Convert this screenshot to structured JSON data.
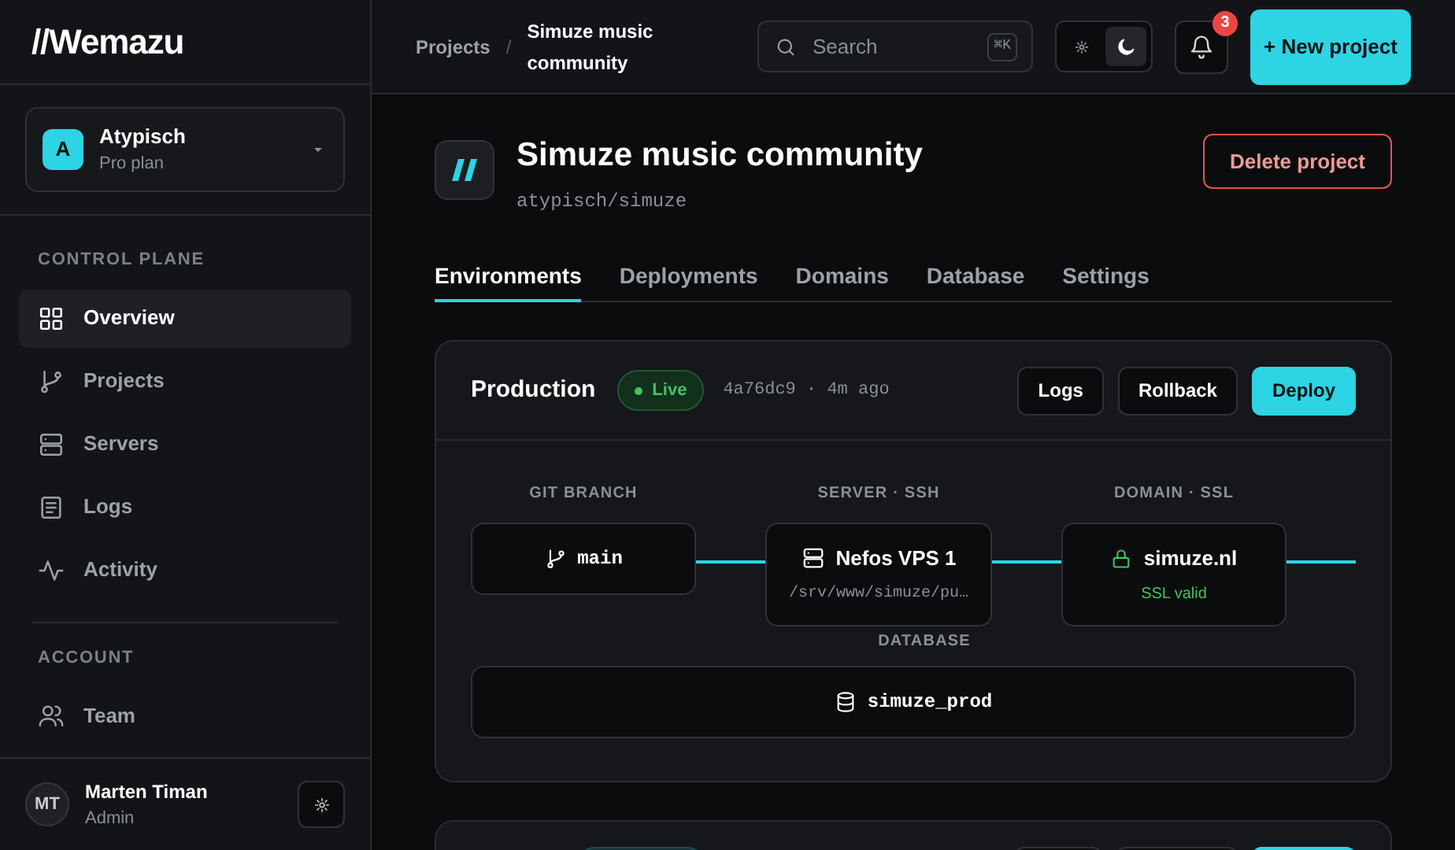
{
  "brand": {
    "logo": "//Wemazu"
  },
  "workspace": {
    "initial": "A",
    "name": "Atypisch",
    "plan": "Pro plan"
  },
  "nav": [
    {
      "heading": "CONTROL PLANE",
      "items": [
        {
          "label": "Overview",
          "selected": true
        },
        {
          "label": "Projects",
          "selected": false
        },
        {
          "label": "Servers",
          "selected": false
        },
        {
          "label": "Logs",
          "selected": false
        },
        {
          "label": "Activity",
          "selected": false
        }
      ]
    },
    {
      "heading": "ACCOUNT",
      "items": [
        {
          "label": "Team",
          "selected": false
        }
      ]
    }
  ],
  "user": {
    "initials": "MT",
    "name": "Marten Timan",
    "role": "Admin"
  },
  "header": {
    "breadcrumb": [
      "Projects",
      "Simuze music community"
    ],
    "separator": "/",
    "search": {
      "placeholder": "Search",
      "shortcut": "⌘K"
    },
    "theme": [
      {
        "kind": "light",
        "selected": false
      },
      {
        "kind": "dark",
        "selected": true
      }
    ],
    "notifications": "3",
    "new_button": "+ New project"
  },
  "project": {
    "title": "Simuze music community",
    "slug": "atypisch/simuze",
    "delete_button": "Delete project"
  },
  "tabs": [
    {
      "label": "Environments",
      "selected": true
    },
    {
      "label": "Deployments",
      "selected": false
    },
    {
      "label": "Domains",
      "selected": false
    },
    {
      "label": "Database",
      "selected": false
    },
    {
      "label": "Settings",
      "selected": false
    }
  ],
  "environments": [
    {
      "kind": "full",
      "name": "Production",
      "status": "Live",
      "commit": "4a76dc9 · 4m ago",
      "actions": [
        {
          "label": "Logs",
          "kind": "secondary"
        },
        {
          "label": "Rollback",
          "kind": "secondary"
        },
        {
          "label": "Deploy",
          "kind": "primary"
        }
      ],
      "pipeline": {
        "git": {
          "label": "GIT BRANCH",
          "value": "main"
        },
        "server": {
          "label": "SERVER · SSH",
          "name": "Nefos VPS 1",
          "path": "/srv/www/simuze/pu…"
        },
        "domain": {
          "label": "DOMAIN · SSL",
          "name": "simuze.nl",
          "ssl": "SSL valid"
        },
        "database": {
          "label": "DATABASE",
          "name": "simuze_prod"
        }
      }
    },
    {
      "kind": "cut-off"
    }
  ]
}
